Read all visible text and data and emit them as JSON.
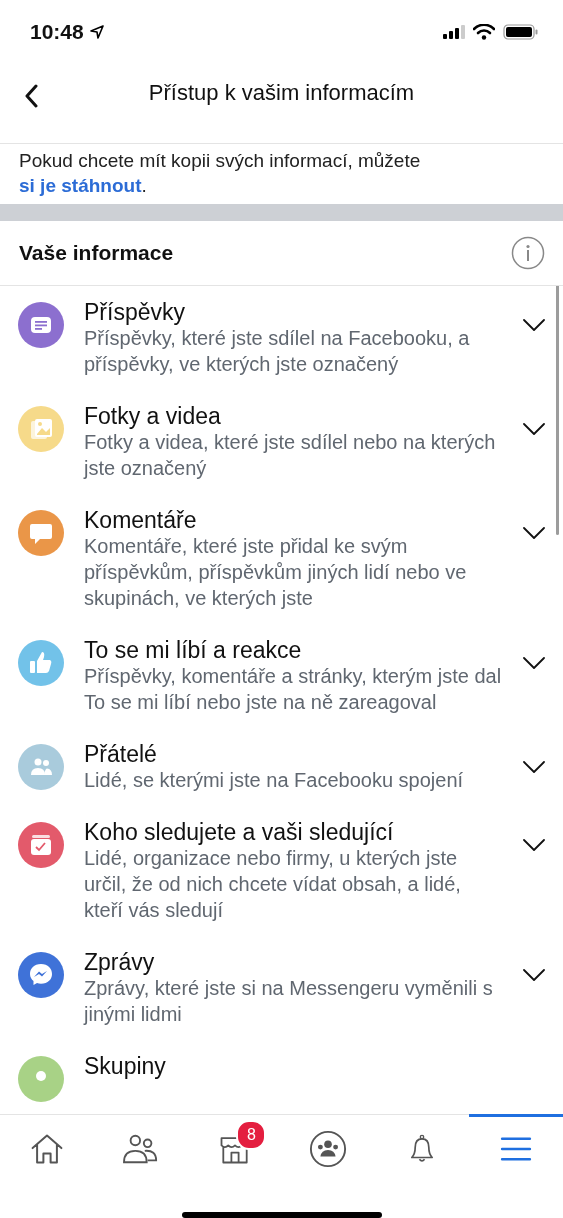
{
  "status_bar": {
    "time": "10:48"
  },
  "header": {
    "title": "Přístup k vašim informacím"
  },
  "intro": {
    "text": "Pokud chcete mít kopii svých informací, můžete",
    "link": "si je stáhnout",
    "tail": "."
  },
  "section": {
    "title": "Vaše informace"
  },
  "items": [
    {
      "kind": "posts",
      "color": "#8c6fcf",
      "title": "Příspěvky",
      "description": "Příspěvky, které jste sdílel na Facebooku, a příspěvky, ve kterých jste označený",
      "expanded": false
    },
    {
      "kind": "photos",
      "color": "#f6da8a",
      "title": "Fotky a videa",
      "description": "Fotky a videa, které jste sdílel nebo na kterých jste označený",
      "expanded": false
    },
    {
      "kind": "comments",
      "color": "#ea9648",
      "title": "Komentáře",
      "description": "Komentáře, které jste přidal ke svým příspěvkům, příspěvkům jiných lidí nebo ve skupinách, ve kterých jste",
      "expanded": false
    },
    {
      "kind": "likes",
      "color": "#72c2e9",
      "title": "To se mi líbí a reakce",
      "description": "Příspěvky, komentáře a stránky, kterým jste dal To se mi líbí nebo jste na ně zareagoval",
      "expanded": false
    },
    {
      "kind": "friends",
      "color": "#a9cbdc",
      "title": "Přátelé",
      "description": "Lidé, se kterými jste na Facebooku spojení",
      "expanded": false
    },
    {
      "kind": "following",
      "color": "#e35a6b",
      "title": "Koho sledujete a vaši sledující",
      "description": "Lidé, organizace nebo firmy, u kterých jste určil, že od nich chcete vídat obsah, a lidé, kteří vás sledují",
      "expanded": false
    },
    {
      "kind": "messages",
      "color": "#3f72d8",
      "title": "Zprávy",
      "description": "Zprávy, které jste si na Messengeru vyměnili s jinými lidmi",
      "expanded": false
    },
    {
      "kind": "groups",
      "color": "#a8d286",
      "title": "Skupiny"
    }
  ],
  "tabs": [
    {
      "kind": "home",
      "selected": false
    },
    {
      "kind": "friends",
      "selected": false
    },
    {
      "kind": "marketplace",
      "selected": false,
      "badge": "8"
    },
    {
      "kind": "groups",
      "selected": false
    },
    {
      "kind": "notifications",
      "selected": false
    },
    {
      "kind": "menu",
      "selected": true
    }
  ]
}
